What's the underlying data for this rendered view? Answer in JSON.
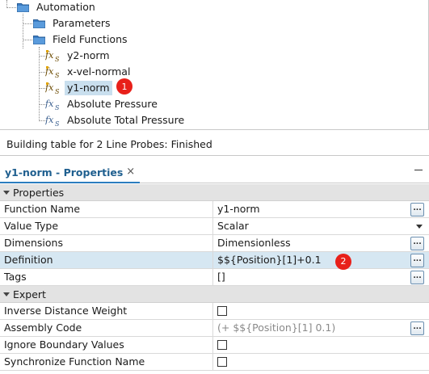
{
  "tree": {
    "items": [
      {
        "label": "Automation",
        "icon": "folder-icon"
      },
      {
        "label": "Parameters",
        "icon": "folder-icon"
      },
      {
        "label": "Field Functions",
        "icon": "folder-icon"
      },
      {
        "label": "y2-norm",
        "icon": "user-field-function-icon"
      },
      {
        "label": "x-vel-normal",
        "icon": "user-field-function-icon"
      },
      {
        "label": "y1-norm",
        "icon": "user-field-function-icon",
        "selected": true
      },
      {
        "label": "Absolute Pressure",
        "icon": "field-function-icon"
      },
      {
        "label": "Absolute Total Pressure",
        "icon": "field-function-icon"
      }
    ],
    "icon_glyph": "fx",
    "icon_subscript": "S"
  },
  "badges": {
    "one": "1",
    "two": "2"
  },
  "status": {
    "text": "Building table for 2 Line Probes: Finished"
  },
  "properties_tab": {
    "title": "y1-norm - Properties",
    "close": "×"
  },
  "grid": {
    "section_properties": "Properties",
    "section_expert": "Expert",
    "ellipsis": "...",
    "rows": {
      "function_name": {
        "name": "Function Name",
        "value": "y1-norm"
      },
      "value_type": {
        "name": "Value Type",
        "value": "Scalar"
      },
      "dimensions": {
        "name": "Dimensions",
        "value": "Dimensionless"
      },
      "definition": {
        "name": "Definition",
        "value": "$${Position}[1]+0.1"
      },
      "tags": {
        "name": "Tags",
        "value": "[]"
      },
      "idw": {
        "name": "Inverse Distance Weight",
        "checked": false
      },
      "assembly": {
        "name": "Assembly Code",
        "value": "(+ $${Position}[1] 0.1)"
      },
      "ignore_boundary": {
        "name": "Ignore Boundary Values",
        "checked": false
      },
      "sync_name": {
        "name": "Synchronize Function Name",
        "checked": false
      }
    }
  },
  "colors": {
    "folder": "#3b7dc4",
    "selection": "#c9dfee",
    "highlight_row": "#d6e7f2",
    "badge": "#e8201a",
    "tab_accent": "#2c7dbf"
  }
}
